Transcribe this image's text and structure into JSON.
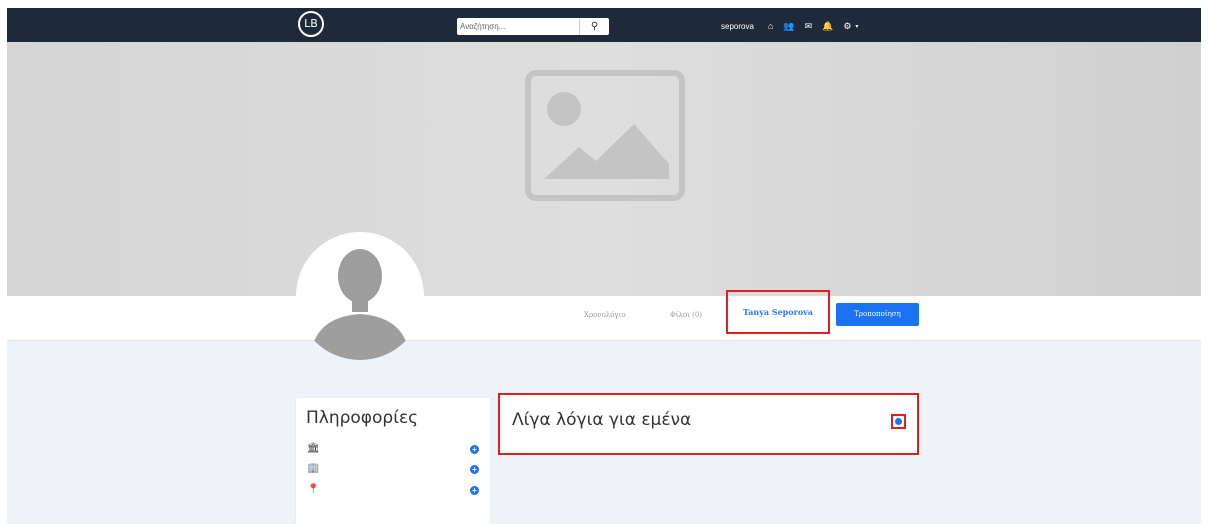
{
  "header": {
    "logo_text": "LB",
    "search": {
      "placeholder": "Αναζήτηση..."
    },
    "username": "seporova",
    "icons": [
      "home-icon",
      "users-icon",
      "mail-icon",
      "bell-icon",
      "gear-icon"
    ]
  },
  "tabs": {
    "timeline": "Χρονολόγιο",
    "friends": "Φίλοι (0)",
    "name": "Tanya Seporova",
    "edit": "Τροποποίηση"
  },
  "info": {
    "title": "Πληροφορίες",
    "rows": [
      {
        "icon": "institution-icon"
      },
      {
        "icon": "building-icon"
      },
      {
        "icon": "location-pin-icon"
      }
    ]
  },
  "about": {
    "title": "Λίγα λόγια για εμένα"
  },
  "colors": {
    "topbar": "#1e2a3a",
    "accent": "#1a73f0",
    "highlight": "#e02020",
    "content_bg": "#eef3f9"
  }
}
